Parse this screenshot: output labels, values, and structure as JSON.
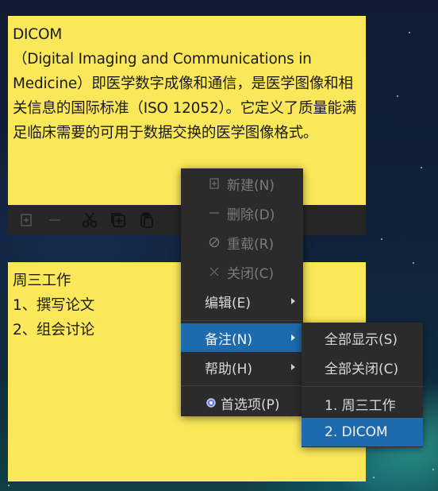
{
  "note1": {
    "text": "DICOM\n（Digital Imaging and Communications in Medicine）即医学数字成像和通信，是医学图像和相关信息的国际标准（ISO 12052）。它定义了质量能满足临床需要的可用于数据交换的医学图像格式。",
    "toolbar": {
      "new_icon": "note-new-icon",
      "delete_icon": "minus-icon",
      "cut_icon": "scissors-icon",
      "copy_icon": "copy-icon",
      "paste_icon": "paste-icon"
    }
  },
  "note2": {
    "text": "周三工作\n1、撰写论文\n2、组会讨论"
  },
  "context_menu": {
    "items": [
      {
        "label": "新建(N)",
        "icon": "new-note-icon",
        "enabled": false
      },
      {
        "label": "删除(D)",
        "icon": "minus-icon",
        "enabled": false
      },
      {
        "label": "重载(R)",
        "icon": "reload-disabled-icon",
        "enabled": false
      },
      {
        "label": "关闭(C)",
        "icon": "close-icon",
        "enabled": false
      },
      {
        "label": "编辑(E)",
        "submenu": true
      },
      {
        "label": "备注(N)",
        "submenu": true,
        "selected": true
      },
      {
        "label": "帮助(H)",
        "submenu": true
      },
      {
        "label": "首选项(P)",
        "icon": "gear-icon"
      }
    ]
  },
  "submenu": {
    "items": [
      {
        "label": "全部显示(S)"
      },
      {
        "label": "全部关闭(C)"
      },
      {
        "label": "1. 周三工作"
      },
      {
        "label": "2. DICOM",
        "selected": true
      }
    ]
  },
  "colors": {
    "note_bg": "#fbe85a",
    "menu_bg": "#2b2b2b",
    "highlight": "#1d6aae"
  }
}
